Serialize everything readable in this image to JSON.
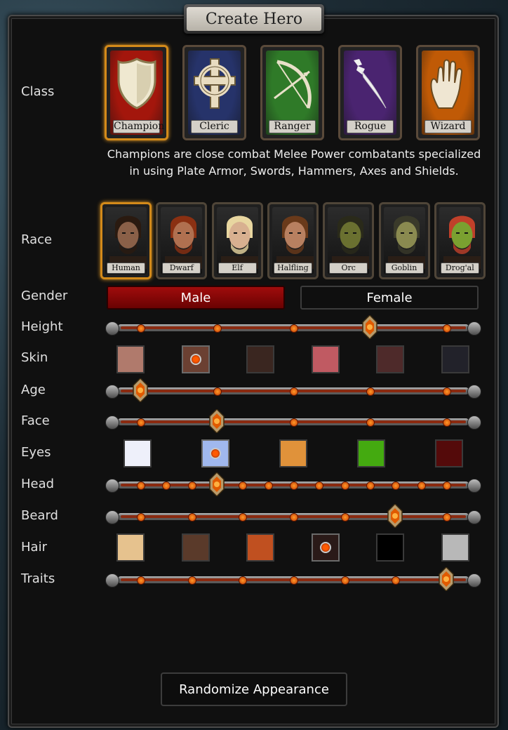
{
  "title": "Create Hero",
  "class_label": "Class",
  "classes": [
    {
      "name": "Champion",
      "icon": "shield-icon",
      "bg": "#a3160c",
      "selected": true
    },
    {
      "name": "Cleric",
      "icon": "celtic-cross-icon",
      "bg": "#26336a",
      "selected": false
    },
    {
      "name": "Ranger",
      "icon": "bow-icon",
      "bg": "#2f7a28",
      "selected": false
    },
    {
      "name": "Rogue",
      "icon": "dagger-icon",
      "bg": "#4a2470",
      "selected": false
    },
    {
      "name": "Wizard",
      "icon": "hand-icon",
      "bg": "#c05a06",
      "selected": false
    }
  ],
  "class_description": "Champions are close combat Melee Power combatants specialized in using Plate Armor, Swords, Hammers, Axes and Shields.",
  "race_label": "Race",
  "races": [
    {
      "name": "Human",
      "selected": true,
      "skin": "#8a6048",
      "hair": "#2a1a10"
    },
    {
      "name": "Dwarf",
      "selected": false,
      "skin": "#b07050",
      "hair": "#8a3012"
    },
    {
      "name": "Elf",
      "selected": false,
      "skin": "#d8b090",
      "hair": "#e8d6a0"
    },
    {
      "name": "Halfling",
      "selected": false,
      "skin": "#b88060",
      "hair": "#6a3a1a"
    },
    {
      "name": "Orc",
      "selected": false,
      "skin": "#6a7030",
      "hair": "#2a2a1a"
    },
    {
      "name": "Goblin",
      "selected": false,
      "skin": "#8a8a50",
      "hair": "#3a3a2a"
    },
    {
      "name": "Drog'al",
      "selected": false,
      "skin": "#7aa030",
      "hair": "#c0402a"
    }
  ],
  "gender_label": "Gender",
  "gender": {
    "male": "Male",
    "female": "Female",
    "selected": "Male"
  },
  "rows": {
    "height": {
      "label": "Height",
      "steps": 5,
      "value_index": 3
    },
    "skin": {
      "label": "Skin",
      "colors": [
        "#b07a6c",
        "#6b4032",
        "#3a2620",
        "#c05a62",
        "#4e2a2a",
        "#22222a"
      ],
      "selected_index": 1
    },
    "age": {
      "label": "Age",
      "steps": 5,
      "value_index": 0
    },
    "face": {
      "label": "Face",
      "steps": 5,
      "value_index": 1
    },
    "eyes": {
      "label": "Eyes",
      "colors": [
        "#eef0fa",
        "#a0b8ee",
        "#e0923a",
        "#44aa10",
        "#540a0a"
      ],
      "selected_index": 1
    },
    "head": {
      "label": "Head",
      "steps": 13,
      "value_index": 3
    },
    "beard": {
      "label": "Beard",
      "steps": 7,
      "value_index": 5
    },
    "hair": {
      "label": "Hair",
      "colors": [
        "#e6c28e",
        "#5a3a2a",
        "#c05020",
        "#2a1a18",
        "#000000",
        "#b8b8b8"
      ],
      "selected_index": 3
    },
    "traits": {
      "label": "Traits",
      "steps": 7,
      "value_index": 6
    }
  },
  "randomize_label": "Randomize Appearance"
}
